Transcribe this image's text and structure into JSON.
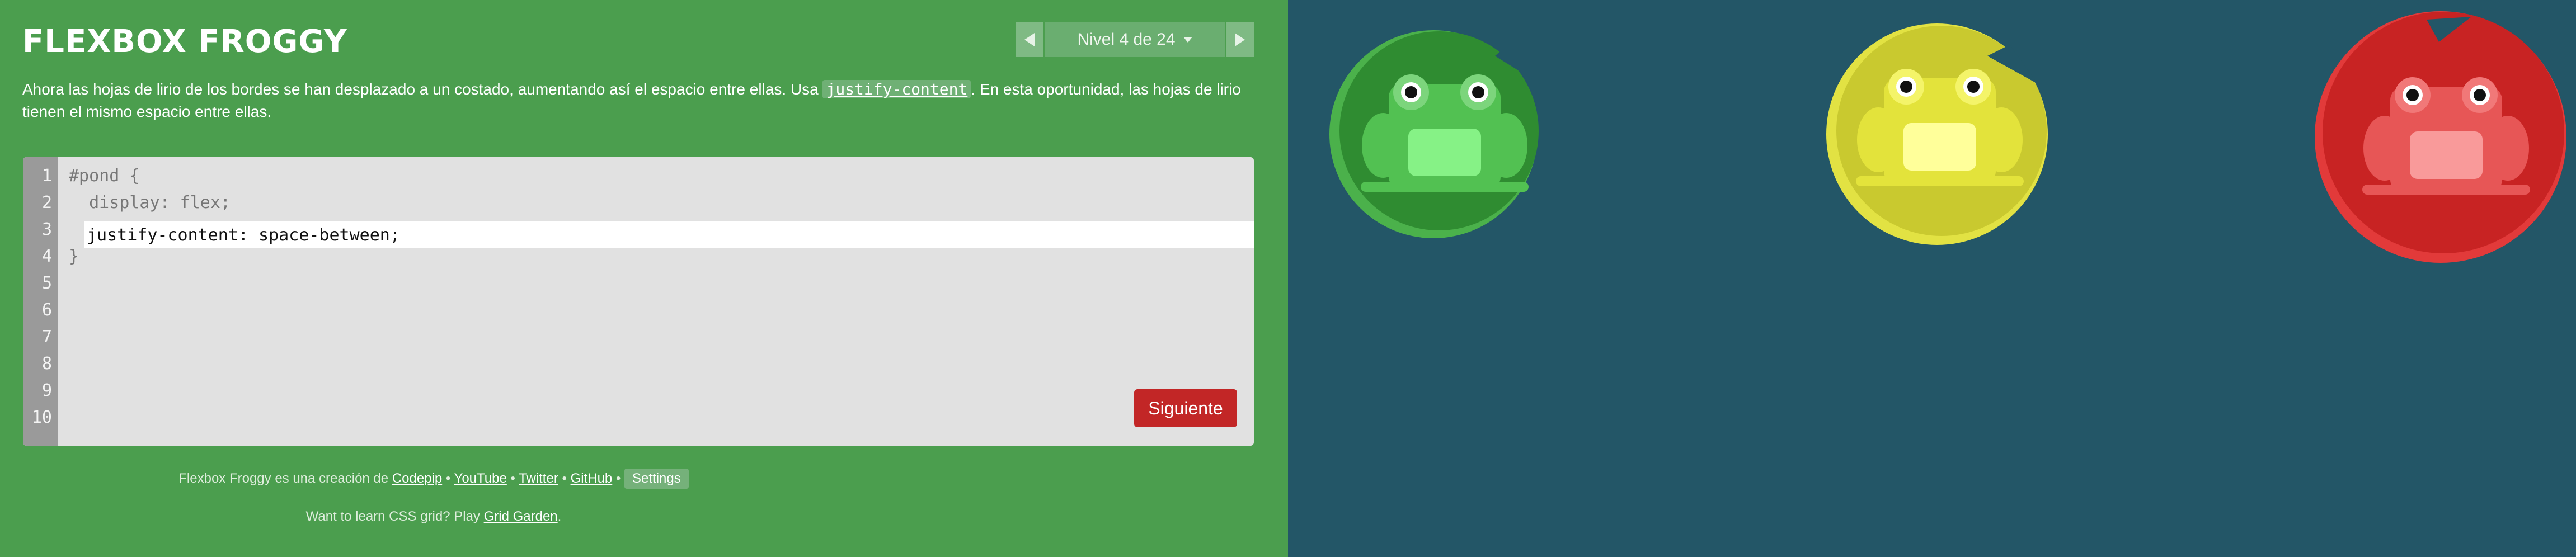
{
  "app": {
    "title": "FLEXBOX FROGGY"
  },
  "level": {
    "label": "Nivel 4 de 24"
  },
  "instructions": {
    "before": "Ahora las hojas de lirio de los bordes se han desplazado a un costado, aumentando así el espacio entre ellas. Usa ",
    "code": "justify-content",
    "after": ". En esta oportunidad, las hojas de lirio tienen el mismo espacio entre ellas."
  },
  "editor": {
    "line_numbers": [
      "1",
      "2",
      "3",
      "4",
      "5",
      "6",
      "7",
      "8",
      "9",
      "10"
    ],
    "line1": "#pond {",
    "line2": "  display: flex;",
    "input_value": "justify-content: space-between;",
    "line4": "}",
    "next_label": "Siguiente"
  },
  "footer": {
    "credit_prefix": "Flexbox Froggy es una creación de",
    "codepip": "Codepip",
    "youtube": "YouTube",
    "twitter": "Twitter",
    "github": "GitHub",
    "separator": "•",
    "settings": "Settings",
    "grid_prefix": "Want to learn CSS grid? Play",
    "grid_link": "Grid Garden",
    "grid_suffix": "."
  },
  "board": {
    "frogs": [
      {
        "color": "green",
        "body": "#52c152",
        "eye_bg": "#7cd57c",
        "belly": "#86f286",
        "pad": "#2f8c31",
        "pad_rim": "#4bb14b"
      },
      {
        "color": "yellow",
        "body": "#e3e33b",
        "eye_bg": "#f4f469",
        "belly": "#ffff9a",
        "pad": "#c9c92f",
        "pad_rim": "#e2e243"
      },
      {
        "color": "red",
        "body": "#e75656",
        "eye_bg": "#f17878",
        "belly": "#f99a9a",
        "pad": "#c82323",
        "pad_rim": "#e23a3a"
      }
    ]
  }
}
